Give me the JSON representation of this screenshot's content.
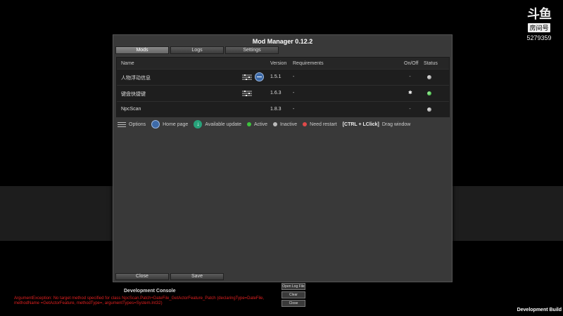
{
  "watermark": {
    "logo": "斗鱼",
    "sub": "房间号",
    "room": "5279359"
  },
  "window": {
    "title": "Mod Manager 0.12.2",
    "tabs": [
      {
        "label": "Mods",
        "active": true
      },
      {
        "label": "Logs",
        "active": false
      },
      {
        "label": "Settings",
        "active": false
      }
    ]
  },
  "table": {
    "headers": {
      "name": "Name",
      "version": "Version",
      "requirements": "Requirements",
      "onoff": "On/Off",
      "status": "Status"
    },
    "rows": [
      {
        "name": "人物浮动信息",
        "version": "1.5.1",
        "requirements": "-",
        "enabled": false,
        "status": "inactive",
        "has_options": true,
        "has_homepage": true
      },
      {
        "name": "键盘快捷键",
        "version": "1.6.3",
        "requirements": "-",
        "enabled": true,
        "status": "active",
        "has_options": true,
        "has_homepage": false
      },
      {
        "name": "NpcScan",
        "version": "1.8.3",
        "requirements": "-",
        "enabled": false,
        "status": "inactive",
        "has_options": false,
        "has_homepage": false
      }
    ]
  },
  "legend": {
    "options": "Options",
    "home_page": "Home page",
    "available_update": "Available update",
    "active": "Active",
    "inactive": "Inactive",
    "need_restart": "Need restart",
    "keys": "[CTRL + LClick]",
    "drag": "Drag window"
  },
  "buttons": {
    "close": "Close",
    "save": "Save"
  },
  "console": {
    "title": "Development Console",
    "error": "ArgumentException: No target method specified for class NpcScan.Patch+DateFile_GetActorFeature_Patch (declaringType=DateFile, methodName =GetActorFeature, methodType=, argumentTypes=System.Int32)",
    "open_log": "Open Log File",
    "clear": "Clear",
    "close": "Close"
  },
  "dev_build": "Development Build",
  "colors": {
    "active": "#3ec43e",
    "inactive": "#bbbbbb",
    "need_restart": "#e04a4a",
    "error_text": "#e02020",
    "home": "#3d6aa8",
    "update": "#27a27a"
  }
}
